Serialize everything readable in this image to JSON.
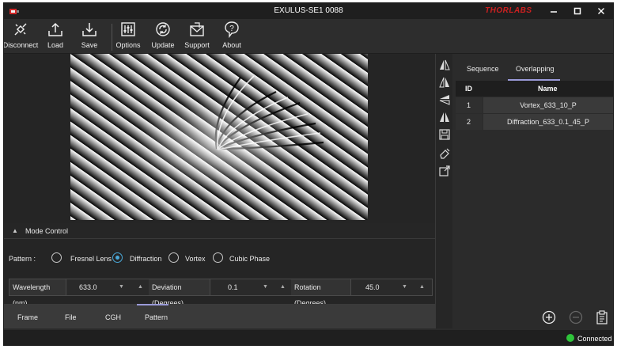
{
  "window": {
    "title": "EXULUS-SE1 0088",
    "brand": "THORLABS"
  },
  "toolbar": {
    "disconnect": "Disconnect",
    "load": "Load",
    "save": "Save",
    "options": "Options",
    "update": "Update",
    "support": "Support",
    "about": "About"
  },
  "mode_control": {
    "title": "Mode Control",
    "pattern_label": "Pattern :",
    "options": [
      "Fresnel Lens",
      "Diffraction",
      "Vortex",
      "Cubic Phase"
    ],
    "selected": "Diffraction"
  },
  "params": {
    "wavelength_label": "Wavelength (nm)",
    "wavelength_value": "633.0",
    "deviation_label": "Deviation (Degrees)",
    "deviation_value": "0.1",
    "rotation_label": "Rotation (Degrees)",
    "rotation_value": "45.0"
  },
  "bottom_tabs": [
    "Frame",
    "File",
    "CGH",
    "Pattern"
  ],
  "right_tabs": [
    "Sequence",
    "Overlapping"
  ],
  "table": {
    "headers": {
      "id": "ID",
      "name": "Name"
    },
    "rows": [
      {
        "id": "1",
        "name": "Vortex_633_10_P"
      },
      {
        "id": "2",
        "name": "Diffraction_633_0.1_45_P"
      }
    ]
  },
  "status": {
    "text": "Connected",
    "color": "#2ec43a"
  },
  "colors": {
    "accent": "#9a9ad8",
    "radio_on": "#4aa8d8",
    "brand": "#cc2020"
  }
}
